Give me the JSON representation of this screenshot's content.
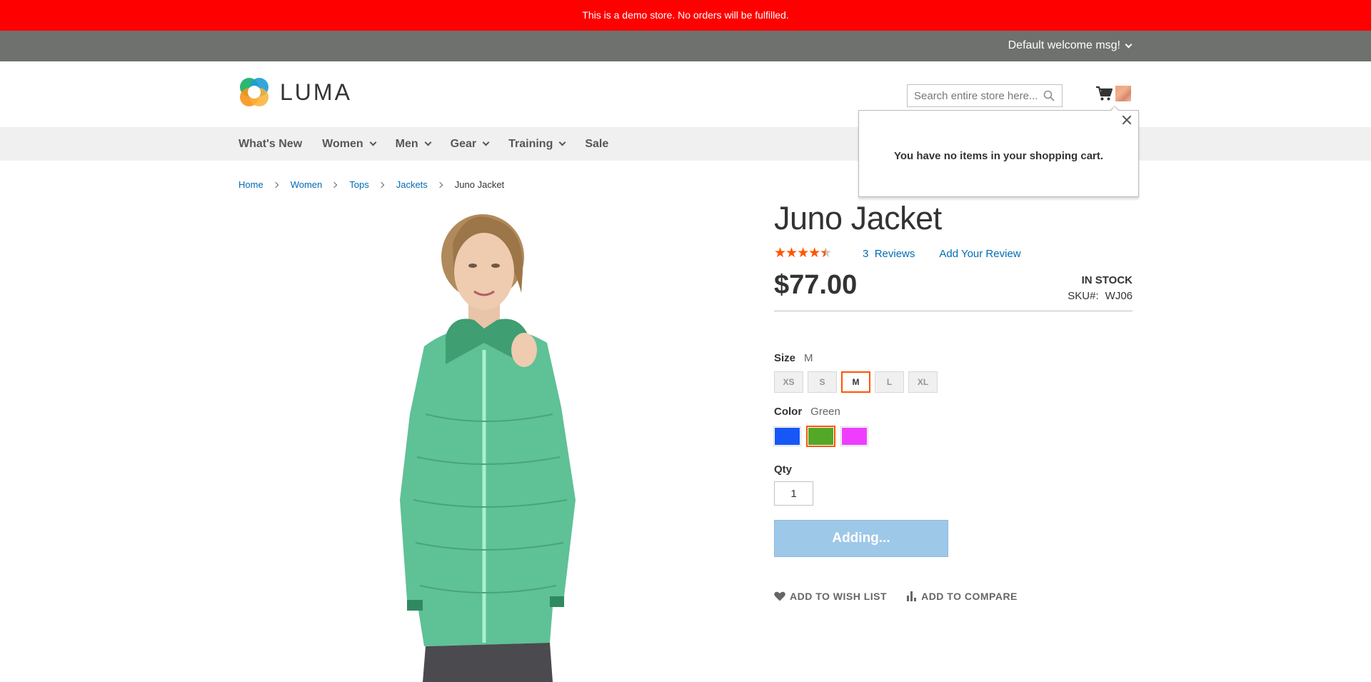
{
  "notice": {
    "text": "This is a demo store. No orders will be fulfilled."
  },
  "panel": {
    "welcome": "Default welcome msg!"
  },
  "logo": {
    "text": "LUMA"
  },
  "search": {
    "placeholder": "Search entire store here..."
  },
  "minicart": {
    "empty_message": "You have no items in your shopping cart."
  },
  "nav": {
    "items": [
      {
        "label": "What's New",
        "dropdown": false
      },
      {
        "label": "Women",
        "dropdown": true
      },
      {
        "label": "Men",
        "dropdown": true
      },
      {
        "label": "Gear",
        "dropdown": true
      },
      {
        "label": "Training",
        "dropdown": true
      },
      {
        "label": "Sale",
        "dropdown": false
      }
    ]
  },
  "breadcrumbs": {
    "items": [
      "Home",
      "Women",
      "Tops",
      "Jackets"
    ],
    "current": "Juno Jacket"
  },
  "product": {
    "title": "Juno Jacket",
    "rating_percent": 80,
    "reviews_count": "3",
    "reviews_word": "Reviews",
    "add_review": "Add Your Review",
    "price": "$77.00",
    "stock": "IN STOCK",
    "sku_label": "SKU#:",
    "sku": "WJ06",
    "size_label": "Size",
    "size_selected": "M",
    "sizes": [
      "XS",
      "S",
      "M",
      "L",
      "XL"
    ],
    "color_label": "Color",
    "color_selected": "Green",
    "colors": [
      {
        "name": "Blue",
        "hex": "#1857f7"
      },
      {
        "name": "Green",
        "hex": "#53a828"
      },
      {
        "name": "Purple",
        "hex": "#ef3dff"
      }
    ],
    "qty_label": "Qty",
    "qty": "1",
    "add_to_cart": "Adding...",
    "wishlist": "ADD TO WISH LIST",
    "compare": "ADD TO COMPARE"
  },
  "colors": {
    "notice_bg": "#ff0000",
    "panel_bg": "#6e716e",
    "link": "#006bb4",
    "accent": "#ff5501",
    "button_disabled": "#9ec8e8"
  }
}
